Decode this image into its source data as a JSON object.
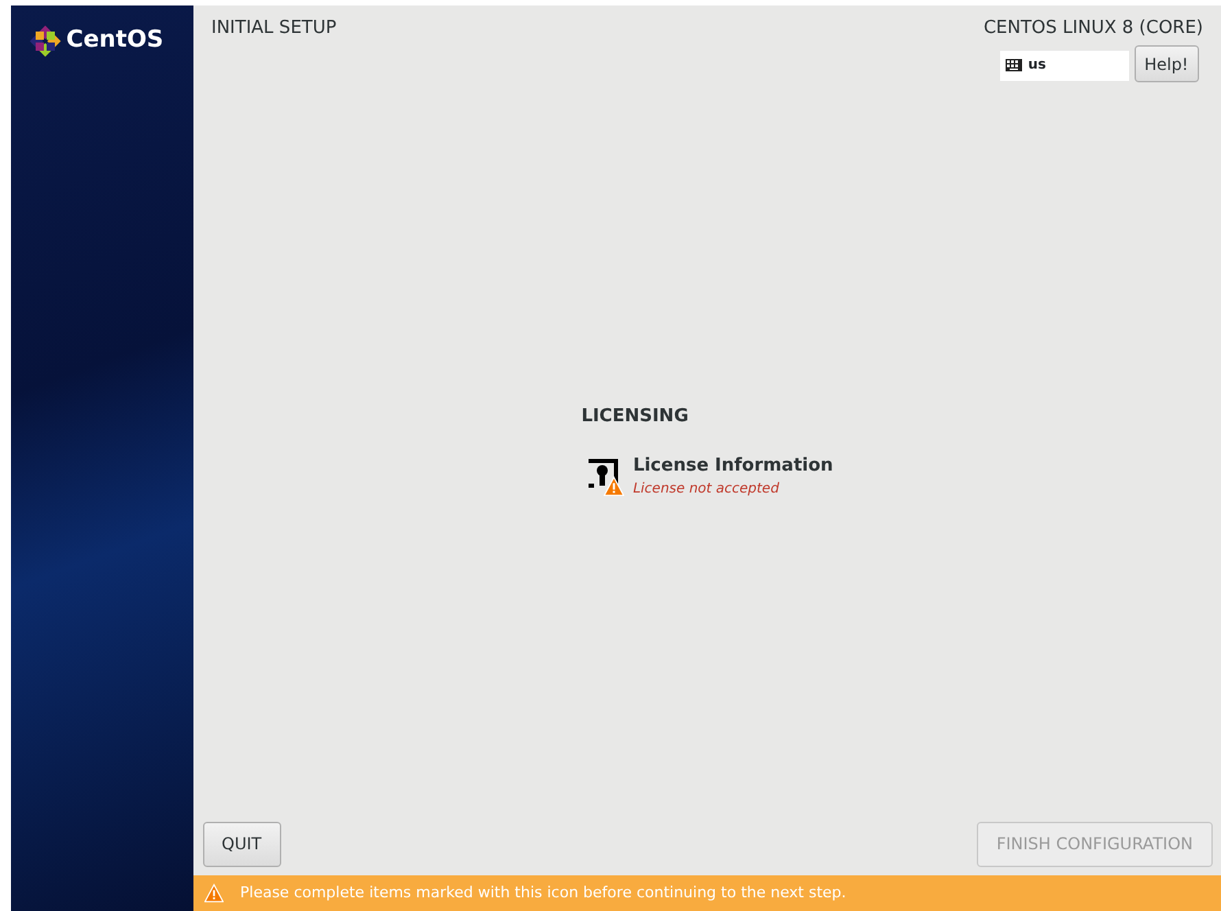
{
  "sidebar": {
    "logo_text": "CentOS"
  },
  "header": {
    "title": "INITIAL SETUP",
    "product": "CENTOS LINUX 8 (CORE)",
    "keyboard_layout": "us",
    "help_button": "Help!"
  },
  "sections": [
    {
      "title": "LICENSING",
      "items": [
        {
          "title": "License Information",
          "status": "License not accepted",
          "warning": true
        }
      ]
    }
  ],
  "buttons": [
    {
      "label": "QUIT",
      "disabled": false
    },
    {
      "label": "FINISH CONFIGURATION",
      "disabled": true
    }
  ],
  "warning_bar": {
    "message": "Please complete items marked with this icon before continuing to the next step."
  }
}
